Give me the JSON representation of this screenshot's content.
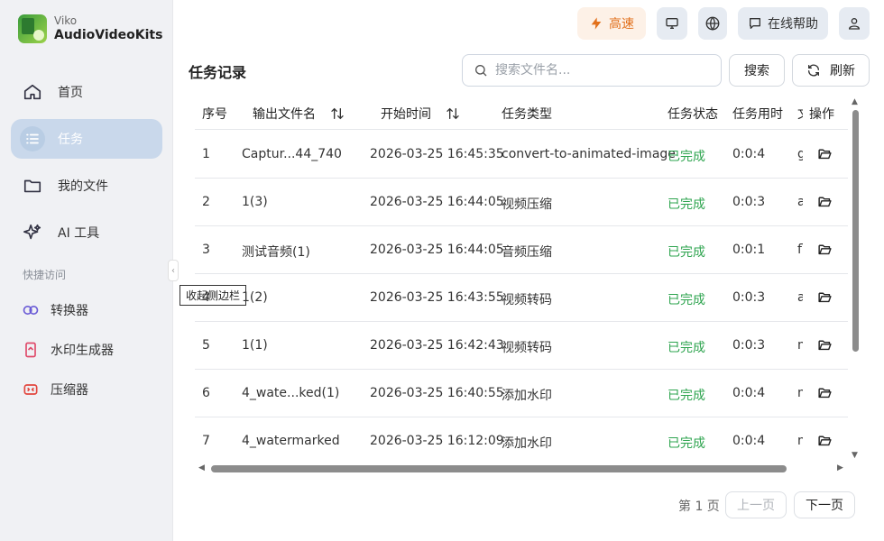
{
  "brand": {
    "sub": "Viko",
    "name": "AudioVideoKits"
  },
  "nav": [
    {
      "label": "首页",
      "icon": "home-icon"
    },
    {
      "label": "任务",
      "icon": "list-icon"
    },
    {
      "label": "我的文件",
      "icon": "folder-icon"
    },
    {
      "label": "AI 工具",
      "icon": "sparkle-icon"
    }
  ],
  "quick_access": {
    "label": "快捷访问",
    "items": [
      {
        "label": "转换器",
        "icon": "converter-icon",
        "color": "#6b5cd6"
      },
      {
        "label": "水印生成器",
        "icon": "watermark-icon",
        "color": "#e04a6a"
      },
      {
        "label": "压缩器",
        "icon": "compressor-icon",
        "color": "#e2463d"
      }
    ]
  },
  "sidebar_tooltip": "收起侧边栏",
  "topbar": {
    "speed_label": "高速",
    "help_label": "在线帮助",
    "accent": "#e2701b"
  },
  "page_title": "任务记录",
  "search": {
    "placeholder": "搜索文件名...",
    "button": "搜索"
  },
  "refresh_label": "刷新",
  "table": {
    "columns": [
      "序号",
      "输出文件名",
      "开始时间",
      "任务类型",
      "任务状态",
      "任务用时",
      "文",
      "操作"
    ],
    "rows": [
      {
        "no": "1",
        "name": "Captur...44_740",
        "time": "2026-03-25 16:45:35",
        "type": "convert-to-animated-image",
        "status": "已完成",
        "duration": "0:0:4",
        "ext": "g"
      },
      {
        "no": "2",
        "name": "1(3)",
        "time": "2026-03-25 16:44:05",
        "type": "视频压缩",
        "status": "已完成",
        "duration": "0:0:3",
        "ext": "a"
      },
      {
        "no": "3",
        "name": "测试音频(1)",
        "time": "2026-03-25 16:44:05",
        "type": "音频压缩",
        "status": "已完成",
        "duration": "0:0:1",
        "ext": "fl"
      },
      {
        "no": "4",
        "name": "1(2)",
        "time": "2026-03-25 16:43:55",
        "type": "视频转码",
        "status": "已完成",
        "duration": "0:0:3",
        "ext": "a"
      },
      {
        "no": "5",
        "name": "1(1)",
        "time": "2026-03-25 16:42:43",
        "type": "视频转码",
        "status": "已完成",
        "duration": "0:0:3",
        "ext": "m"
      },
      {
        "no": "6",
        "name": "4_wate...ked(1)",
        "time": "2026-03-25 16:40:55",
        "type": "添加水印",
        "status": "已完成",
        "duration": "0:0:4",
        "ext": "m"
      },
      {
        "no": "7",
        "name": "4_watermarked",
        "time": "2026-03-25 16:12:09",
        "type": "添加水印",
        "status": "已完成",
        "duration": "0:0:4",
        "ext": "m"
      }
    ]
  },
  "pager": {
    "page_text": "第 1 页",
    "prev": "上一页",
    "next": "下一页"
  },
  "colors": {
    "success": "#2ea44f",
    "active_nav": "#c9d8eb",
    "sidebar_bg": "#f0f1f4"
  }
}
